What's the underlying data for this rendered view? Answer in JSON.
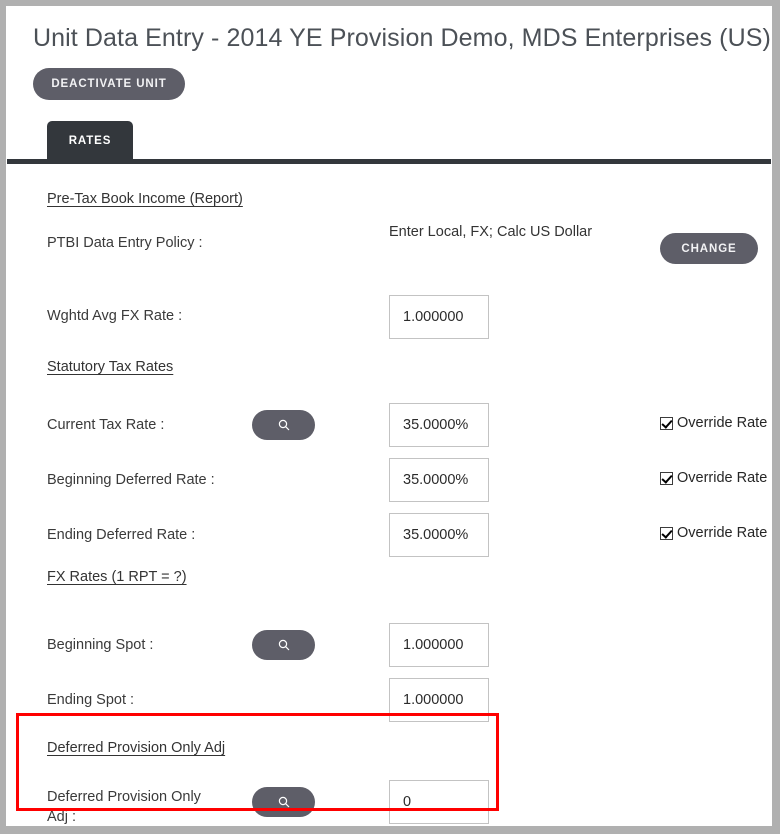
{
  "window": {
    "frame_color": "#b0b0b0",
    "background": "#ffffff"
  },
  "header": {
    "title": "Unit Data Entry - 2014 YE Provision Demo, MDS Enterprises (US)",
    "deactivate_button": "DEACTIVATE UNIT"
  },
  "tabs": [
    {
      "label": "RATES",
      "active": true
    }
  ],
  "sections": [
    {
      "id": "pre-tax-book-income",
      "heading": "Pre-Tax Book Income (Report)",
      "rows": [
        {
          "id": "ptbi-data-entry-policy",
          "label": "PTBI Data Entry Policy :",
          "value_text": "Enter Local, FX; Calc US Dollar",
          "button": "CHANGE"
        },
        {
          "id": "wghtd-avg-fx-rate",
          "label": "Wghtd Avg FX Rate :",
          "input_value": "1.000000"
        }
      ]
    },
    {
      "id": "statutory-tax-rates",
      "heading": "Statutory Tax Rates",
      "rows": [
        {
          "id": "current-tax-rate",
          "label": "Current Tax Rate :",
          "search_icon": "search-icon",
          "input_value": "35.0000%",
          "override_label": "Override Rate",
          "override_checked": true
        },
        {
          "id": "beginning-deferred-rate",
          "label": "Beginning Deferred Rate :",
          "input_value": "35.0000%",
          "override_label": "Override Rate",
          "override_checked": true
        },
        {
          "id": "ending-deferred-rate",
          "label": "Ending Deferred Rate :",
          "input_value": "35.0000%",
          "override_label": "Override Rate",
          "override_checked": true
        }
      ]
    },
    {
      "id": "fx-rates",
      "heading": "FX Rates (1 RPT = ?)",
      "rows": [
        {
          "id": "beginning-spot",
          "label": "Beginning Spot :",
          "search_icon": "search-icon",
          "input_value": "1.000000"
        },
        {
          "id": "ending-spot",
          "label": "Ending Spot :",
          "input_value": "1.000000"
        }
      ]
    },
    {
      "id": "deferred-provision-only-adj",
      "heading": "Deferred Provision Only Adj",
      "highlighted": true,
      "highlight_color": "#ff0000",
      "rows": [
        {
          "id": "deferred-provision-only-adj",
          "label": "Deferred Provision Only Adj :",
          "search_icon": "search-icon",
          "input_value": "0"
        }
      ]
    }
  ],
  "colors": {
    "button_fill": "#5e5e68",
    "tab_fill": "#33373c",
    "title_text": "#4c5157",
    "input_border": "#c3c3c3",
    "highlight": "#ff0000"
  }
}
